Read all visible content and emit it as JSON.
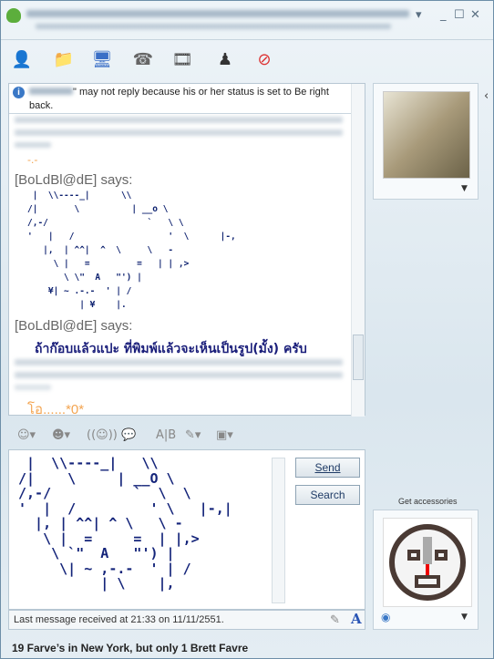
{
  "toolbar": {
    "icons": [
      "add-contact-icon",
      "share-folders-icon",
      "video-call-icon",
      "voice-call-icon",
      "activities-icon",
      "games-icon",
      "block-icon"
    ]
  },
  "chat": {
    "info_text": "\" may not reply because his or her status is set to Be right back.",
    "emoticon_1": "-.-",
    "sender": "[BoLdBl@dE] says:",
    "art_lines": [
      " |  \\\\----_|      \\\\",
      "/|       \\          | __o \\",
      "/,-/                   `   \\ \\",
      "'   |   /                  '  \\      |-,",
      "   |,  | ^^|  ^  \\     \\   -",
      "     \\ |   =         =   | | ,>",
      "       \\ \\\"  A   \"') |",
      "    ¥| ~ .-.-  ' | /",
      "          | ¥    |."
    ],
    "thai_message": "ถ้าก๊อบแล้วแปะ ที่พิมพ์แล้วจะเห็นเป็นรูป(มั้ง) ครับ",
    "last_message": "โอ......*0*"
  },
  "input": {
    "art_lines": [
      " |  \\\\----_|   \\\\",
      "/|    \\     | __O \\",
      "/,-/          `  \\  \\",
      "'  |  /         ' \\   |-,|",
      "  |, | ^^| ^ \\   \\ -",
      "   \\ |  =     =  | |,>",
      "    \\ `\"  A   \"') |",
      "     \\| ~ ,-.-  ' | /",
      "          | \\    |,"
    ]
  },
  "buttons": {
    "send": "Send",
    "search": "Search"
  },
  "status_bar": "Last message received at 21:33 on 11/11/2551.",
  "accessories_label": "Get accessories",
  "personal_message": "19 Farve’s in New York, but only 1 Brett Favre"
}
